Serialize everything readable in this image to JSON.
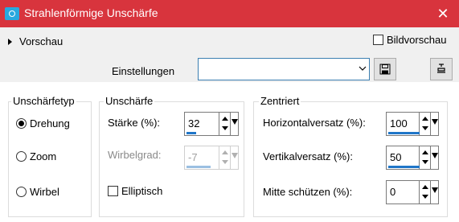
{
  "window": {
    "title": "Strahlenförmige Unschärfe",
    "close": "✕"
  },
  "toolbar": {
    "preview_label": "Vorschau",
    "image_preview_label": "Bildvorschau",
    "image_preview_checked": false,
    "settings_label": "Einstellungen",
    "settings_value": ""
  },
  "blur_type": {
    "legend": "Unschärfetyp",
    "options": [
      {
        "label": "Drehung",
        "selected": true
      },
      {
        "label": "Zoom",
        "selected": false
      },
      {
        "label": "Wirbel",
        "selected": false
      }
    ]
  },
  "blur": {
    "legend": "Unschärfe",
    "strength_label": "Stärke (%):",
    "strength_value": "32",
    "strength_fill": 0.32,
    "twist_label": "Wirbelgrad:",
    "twist_value": "-7",
    "twist_enabled": false,
    "elliptical_label": "Elliptisch",
    "elliptical_checked": false
  },
  "center": {
    "legend": "Zentriert",
    "h_offset_label": "Horizontalversatz (%):",
    "h_offset_value": "100",
    "v_offset_label": "Vertikalversatz (%):",
    "v_offset_value": "50",
    "protect_label": "Mitte schützen (%):",
    "protect_value": "0"
  },
  "colors": {
    "titlebar": "#d8343d",
    "accent": "#2076c8",
    "combo_border": "#3c7fb1"
  }
}
